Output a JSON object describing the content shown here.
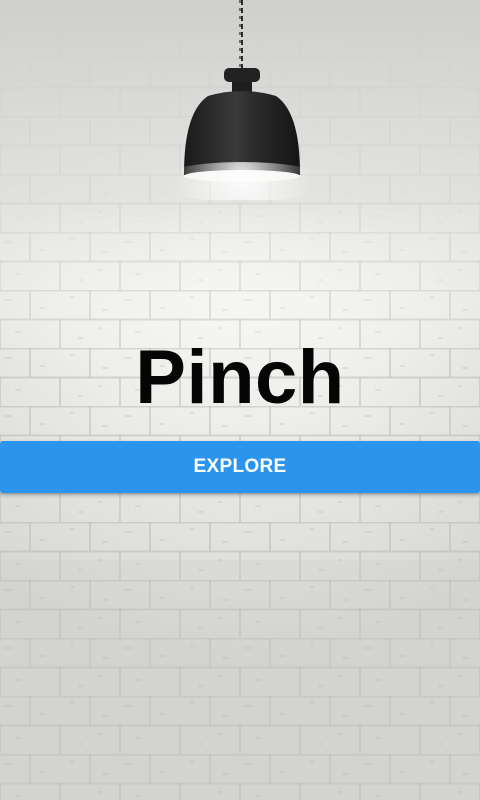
{
  "app": {
    "title": "Pinch",
    "explore_label": "EXPLORE"
  },
  "colors": {
    "button": "#2b95ee",
    "button_text": "#ffffff",
    "title": "#050505",
    "wall": "#e9e9e7",
    "lamp": "#2a2a2a"
  },
  "icons": {
    "background": "brick-wall-image",
    "lamp": "pendant-lamp-image"
  }
}
